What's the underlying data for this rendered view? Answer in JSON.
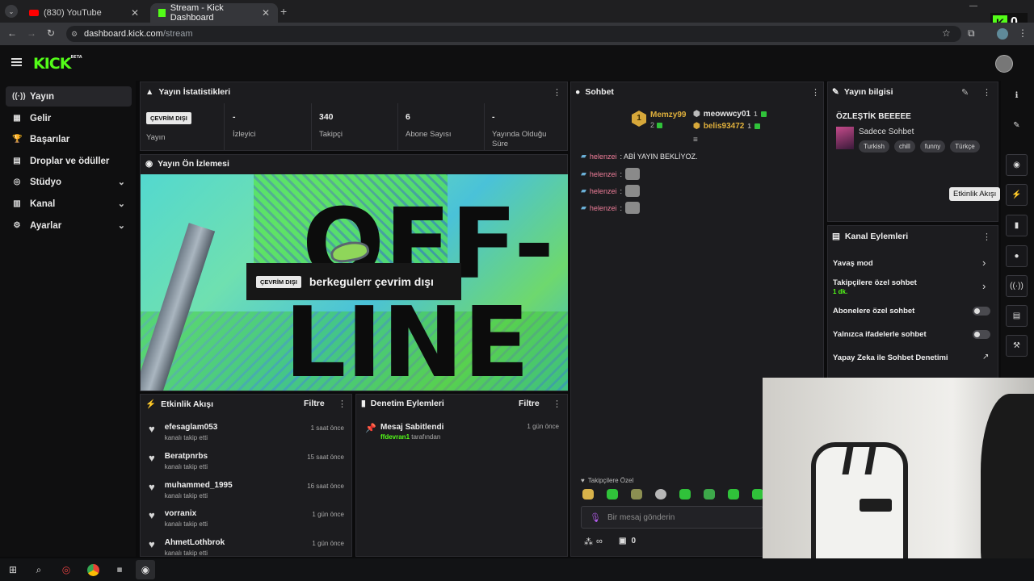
{
  "browser": {
    "tabs": [
      {
        "label": "(830) YouTube"
      },
      {
        "label": "Stream - Kick Dashboard"
      }
    ],
    "url_host": "dashboard.kick.com",
    "url_path": "/stream",
    "kick_counter": "0"
  },
  "app": {
    "logo": "KICK",
    "logo_beta": "BETA"
  },
  "sidebar": {
    "items": [
      {
        "label": "Yayın"
      },
      {
        "label": "Gelir"
      },
      {
        "label": "Başarılar"
      },
      {
        "label": "Droplar ve ödüller"
      },
      {
        "label": "Stüdyo"
      },
      {
        "label": "Kanal"
      },
      {
        "label": "Ayarlar"
      }
    ]
  },
  "stats": {
    "title": "Yayın İstatistikleri",
    "status_badge": "ÇEVRİM DIŞI",
    "status_label": "Yayın",
    "items": [
      {
        "value": "-",
        "label": "İzleyici"
      },
      {
        "value": "340",
        "label": "Takipçi"
      },
      {
        "value": "6",
        "label": "Abone Sayısı"
      },
      {
        "value": "-",
        "label": "Yayında Olduğu Süre"
      }
    ]
  },
  "preview": {
    "title": "Yayın Ön İzlemesi",
    "art_text_top": "OFF-",
    "art_text_bottom": "LINE",
    "overlay_badge": "ÇEVRİM DIŞI",
    "overlay_message": "berkegulerr çevrim dışı"
  },
  "activity": {
    "title": "Etkinlik Akışı",
    "filter_label": "Filtre",
    "items": [
      {
        "name": "efesaglam053",
        "sub": "kanalı takip etti",
        "time": "1 saat önce"
      },
      {
        "name": "Beratpnrbs",
        "sub": "kanalı takip etti",
        "time": "15 saat önce"
      },
      {
        "name": "muhammed_1995",
        "sub": "kanalı takip etti",
        "time": "16 saat önce"
      },
      {
        "name": "vorranix",
        "sub": "kanalı takip etti",
        "time": "1 gün önce"
      },
      {
        "name": "AhmetLothbrok",
        "sub": "kanalı takip etti",
        "time": "1 gün önce"
      }
    ]
  },
  "moderation": {
    "title": "Denetim Eylemleri",
    "filter_label": "Filtre",
    "items": [
      {
        "title": "Mesaj Sabitlendi",
        "user": "ffdevran1",
        "suffix": "tarafından",
        "time": "1 gün önce"
      }
    ]
  },
  "chat": {
    "title": "Sohbet",
    "leaders": [
      {
        "rank": "1",
        "name": "Memzy99",
        "count": "2"
      },
      {
        "name": "meowwcy01",
        "count": "1"
      },
      {
        "name": "belis93472",
        "count": "1"
      }
    ],
    "messages": [
      {
        "user": "helenzei",
        "text": ": ABİ YAYIN BEKLİYOZ."
      },
      {
        "user": "helenzei",
        "text": ":"
      },
      {
        "user": "helenzei",
        "text": ":"
      },
      {
        "user": "helenzei",
        "text": ":"
      }
    ],
    "followers_only_label": "Takipçilere Özel",
    "input_placeholder": "Bir mesaj gönderin",
    "footer_left": "∞",
    "footer_right": "0"
  },
  "stream_info": {
    "title": "Yayın bilgisi",
    "stream_title": "ÖZLEŞTİK BEEEEE",
    "category": "Sadece Sohbet",
    "tags": [
      "Turkish",
      "chill",
      "funny",
      "Türkçe"
    ]
  },
  "channel_actions": {
    "title": "Kanal Eylemleri",
    "items": [
      {
        "label": "Yavaş mod",
        "kind": "chevron"
      },
      {
        "label": "Takipçilere özel sohbet",
        "sub": "1 dk.",
        "kind": "chevron"
      },
      {
        "label": "Abonelere özel sohbet",
        "kind": "toggle"
      },
      {
        "label": "Yalnızca ifadelerle sohbet",
        "kind": "toggle"
      },
      {
        "label": "Yapay Zeka ile Sohbet Denetimi",
        "kind": "external"
      }
    ]
  },
  "rail": {
    "tooltip": "Etkinlik Akışı"
  },
  "colors": {
    "brand": "#53fc18",
    "panel": "#1c1c1f",
    "background": "#0b0b0c",
    "chat_username": "#f17e9a"
  }
}
